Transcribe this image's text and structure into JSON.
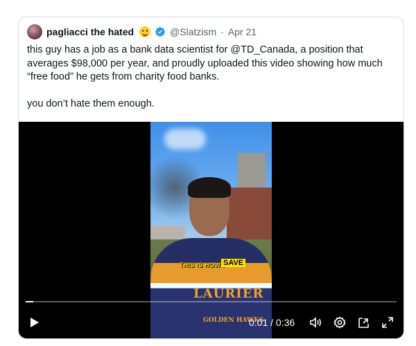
{
  "tweet": {
    "author": {
      "display_name": "pagliacci the hated",
      "emoji_icon": "slightly-smiling-face-icon",
      "handle": "@Slatzism",
      "separator": "·",
      "date": "Apr 21"
    },
    "text_paragraphs": [
      "this guy has a job as a bank data scientist for @TD_Canada, a position that averages $98,000 per year, and proudly uploaded this video showing how much “free food” he gets from charity food banks.",
      "you don’t hate them enough."
    ]
  },
  "video": {
    "caption_overlay": "THIS IS HOW I",
    "caption_highlight": "SAVE",
    "jersey_text": "LAURIER",
    "jersey_subtext": "GOLDEN HAWKS",
    "progress_fraction": 0.02,
    "time_display": "0:01 / 0:36",
    "controls": {
      "play": "play-icon",
      "volume": "volume-icon",
      "settings": "gear-icon",
      "pop_out": "pop-out-icon",
      "fullscreen": "fullscreen-icon"
    }
  },
  "colors": {
    "verified_badge": "#1d9bf0",
    "text_primary": "#0f1419",
    "text_secondary": "#536471",
    "video_background": "#000000"
  }
}
